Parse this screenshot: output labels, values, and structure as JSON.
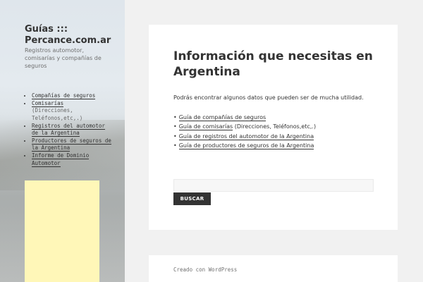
{
  "sidebar": {
    "site_title": "Guías ::: Percance.com.ar",
    "site_description": "Registros automotor, comisarías y compañías de seguros",
    "menu": [
      {
        "label": "Compañías de seguros",
        "note": ""
      },
      {
        "label": "Comisarías",
        "note": "(Direcciones, Teléfonos,etc,.)"
      },
      {
        "label": "Registros del automotor de la Argentina",
        "note": ""
      },
      {
        "label": "Productores de seguros de la Argentina",
        "note": ""
      },
      {
        "label": "Informe de Dominio Automotor",
        "note": ""
      }
    ],
    "widget_color": "#fff7b8"
  },
  "main": {
    "title": "Información que necesitas en Argentina",
    "intro": "Podrás encontrar algunos datos que pueden ser de mucha utilidad.",
    "guides": [
      {
        "label": "Guía de compañías de seguros",
        "suffix": ""
      },
      {
        "label": "Guía de comisarías",
        "suffix": " (Direcciones, Teléfonos,etc,.)"
      },
      {
        "label": "Guía de registros del automotor de la Argentina",
        "suffix": ""
      },
      {
        "label": "Guía de productores de seguros de la Argentina",
        "suffix": ""
      }
    ],
    "search": {
      "placeholder": "",
      "value": "",
      "button_label": "BUSCAR"
    }
  },
  "footer": {
    "credit": "Creado con WordPress"
  }
}
